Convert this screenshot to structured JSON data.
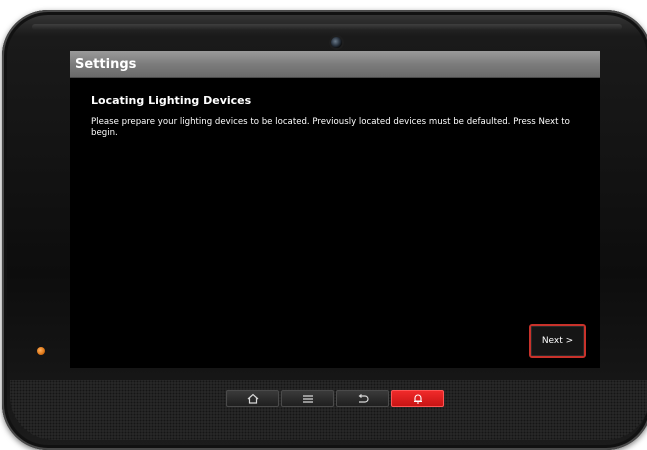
{
  "screen": {
    "title": "Settings",
    "heading": "Locating Lighting Devices",
    "body": "Please prepare your lighting devices to be located.  Previously located devices must be defaulted. Press Next to begin.",
    "next_label": "Next >"
  },
  "nav": [
    {
      "icon": "home-icon"
    },
    {
      "icon": "menu-icon"
    },
    {
      "icon": "back-icon"
    },
    {
      "icon": "alarm-bell-icon"
    }
  ],
  "colors": {
    "titlebar": "#7c7c7c",
    "screen_bg": "#000000",
    "accent_red": "#c8322b",
    "alarm_red": "#e61c1c",
    "led": "#e07a1a"
  }
}
